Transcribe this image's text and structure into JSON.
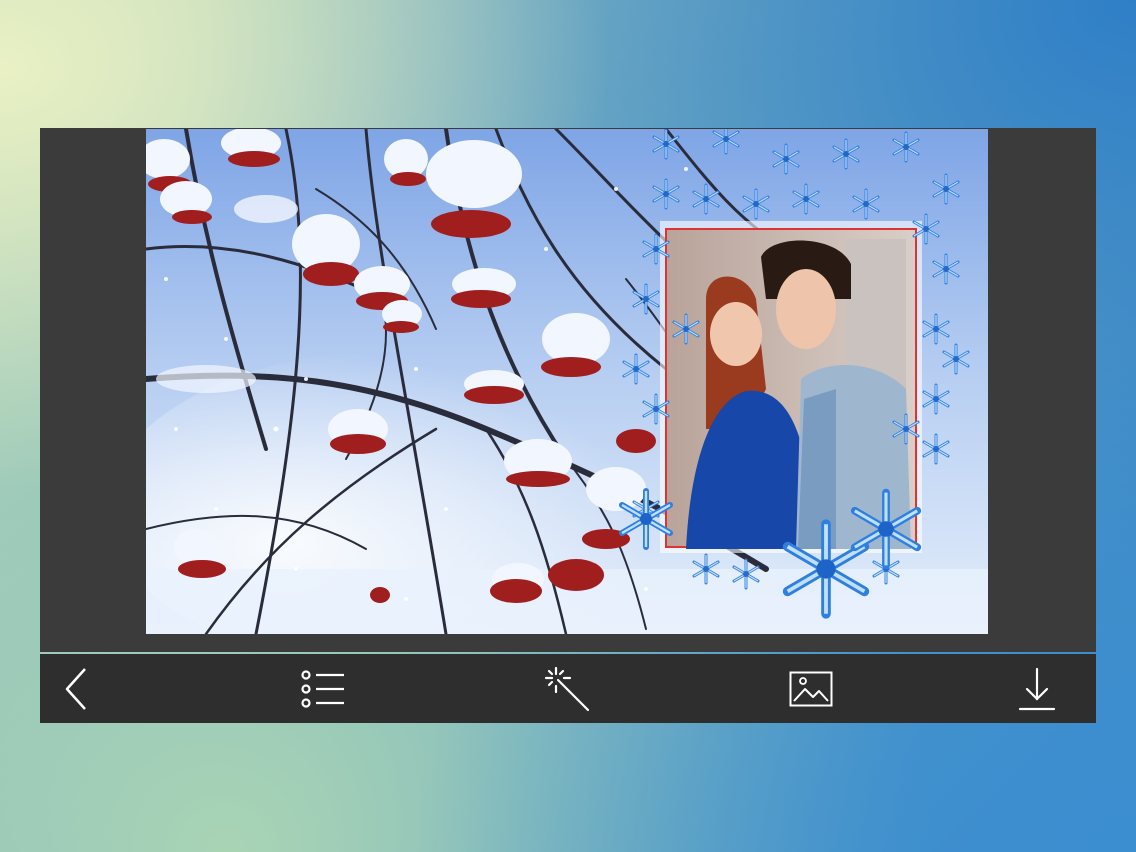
{
  "app": {
    "screen": "photo-frame-editor"
  },
  "canvas": {
    "background_scene": "snowy-rowan-branches",
    "frame_style": "snowflake-frame",
    "photo_subject": "couple-portrait",
    "colors": {
      "sky": "#a9c6ee",
      "snow": "#f2f6ff",
      "berries": "#a11e1e",
      "branches": "#2a2c3c",
      "snowflake": "#2f7fe0"
    }
  },
  "toolbar": {
    "background": "#2e2e2e",
    "icon_color": "#ffffff",
    "items": [
      {
        "icon": "chevron-left-icon",
        "action": "back"
      },
      {
        "icon": "list-icon",
        "action": "frames"
      },
      {
        "icon": "magic-wand-icon",
        "action": "effects"
      },
      {
        "icon": "image-icon",
        "action": "gallery"
      },
      {
        "icon": "download-icon",
        "action": "save"
      }
    ]
  }
}
